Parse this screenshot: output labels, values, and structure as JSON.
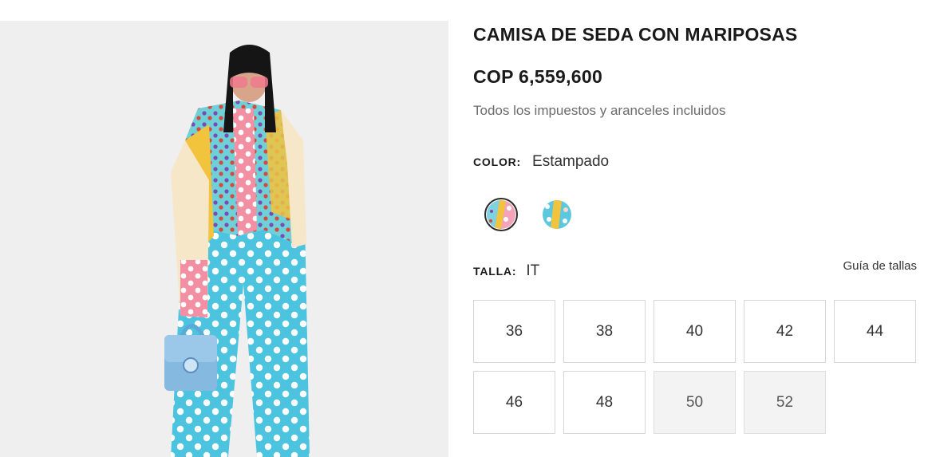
{
  "product": {
    "title": "CAMISA DE SEDA CON MARIPOSAS",
    "price": "COP 6,559,600",
    "tax_note": "Todos los impuestos y aranceles incluidos"
  },
  "color": {
    "label": "COLOR:",
    "value": "Estampado",
    "swatches": [
      {
        "name": "swatch-print-pink",
        "selected": true
      },
      {
        "name": "swatch-print-blue",
        "selected": false
      }
    ]
  },
  "size": {
    "label": "TALLA:",
    "system": "IT",
    "guide_label": "Guía de tallas",
    "options": [
      {
        "label": "36",
        "available": true
      },
      {
        "label": "38",
        "available": true
      },
      {
        "label": "40",
        "available": true
      },
      {
        "label": "42",
        "available": true
      },
      {
        "label": "44",
        "available": true
      },
      {
        "label": "46",
        "available": true
      },
      {
        "label": "48",
        "available": true
      },
      {
        "label": "50",
        "available": false
      },
      {
        "label": "52",
        "available": false
      }
    ]
  },
  "colors": {
    "text": "#1a1a1a",
    "muted": "#6b6b6b",
    "border": "#d6d6d6",
    "unavailable_bg": "#f3f3f3",
    "panel_bg": "#efefef"
  }
}
